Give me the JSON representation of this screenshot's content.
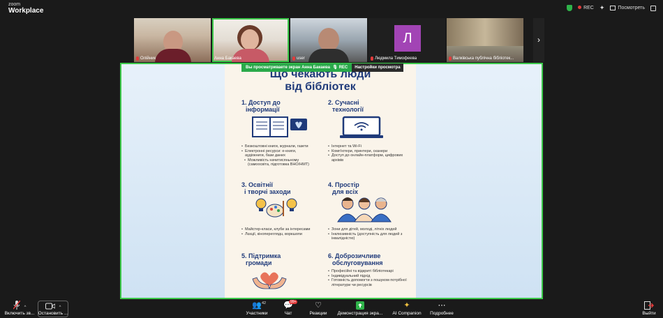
{
  "app": {
    "brand_line1": "zoom",
    "brand_line2": "Workplace"
  },
  "topbar": {
    "rec_label": "REC",
    "view_label": "Посмотреть"
  },
  "participants": [
    {
      "name": "Олійник"
    },
    {
      "name": "Анна Бакаева"
    },
    {
      "name": "user"
    },
    {
      "name": "Людмила Тимофеева",
      "avatar_letter": "Л"
    },
    {
      "name": "Валківська публічна бібліотек..."
    }
  ],
  "share_banner": {
    "viewing_text": "Вы просматриваете экран  Анна Бакаева",
    "rec_label": "REC",
    "settings_label": "Настройки просмотра"
  },
  "poster": {
    "title_line1": "Що чекають люди",
    "title_line2": "від бібліотек",
    "sections": [
      {
        "title_l1": "1. Доступ до",
        "title_l2": "інформації",
        "bullets": [
          "Безкоштовні книги, журнали, газети",
          "Електронні ресурси: е-книги, аудіокниги, бази даних",
          "Можливість начитисяньному (самоосвіта, підготовка ВНО/НМТ)"
        ]
      },
      {
        "title_l1": "2. Сучасні",
        "title_l2": "технології",
        "bullets": [
          "Інтернет та Wi-Fi",
          "Комп'ютери, принтери, сканери",
          "Доступ до онлайн-платформ, цифрових архівів"
        ]
      },
      {
        "title_l1": "3. Освітнії",
        "title_l2": "і творчі заходи",
        "bullets": [
          "Майстер-класи, клуби за інтересами",
          "Лєкції, кінопереглядu, воркшопи"
        ]
      },
      {
        "title_l1": "4. Простір",
        "title_l2": "для всіх",
        "bullets": [
          "Зони для дітей, молоді, літніх людей",
          "Інклюзивність (доступність для людей з інвалідністю)"
        ]
      },
      {
        "title_l1": "5. Підтримка",
        "title_l2": "громади",
        "bullets": []
      },
      {
        "title_l1": "6. Доброзичливе",
        "title_l2": "обслуговування",
        "bullets": [
          "Професійні та відкриті бібліотекарі",
          "Індивідуальний підхід",
          "Готовність допомогти з пошуком потрібної літератури чи ресурсів"
        ]
      }
    ]
  },
  "toolbar": {
    "mic_label": "Включить зв...",
    "video_label": "Остановить ...",
    "participants_label": "Участники",
    "participants_count": "42",
    "chat_label": "Чат",
    "chat_badge": "99+",
    "reactions_label": "Реакции",
    "share_label": "Демонстрация экра...",
    "ai_label": "AI Companion",
    "more_label": "Подробнее",
    "exit_label": "Выйти"
  },
  "colors": {
    "accent_green": "#3cc94a",
    "rec_red": "#e23b3b",
    "poster_navy": "#1f3a7a"
  }
}
